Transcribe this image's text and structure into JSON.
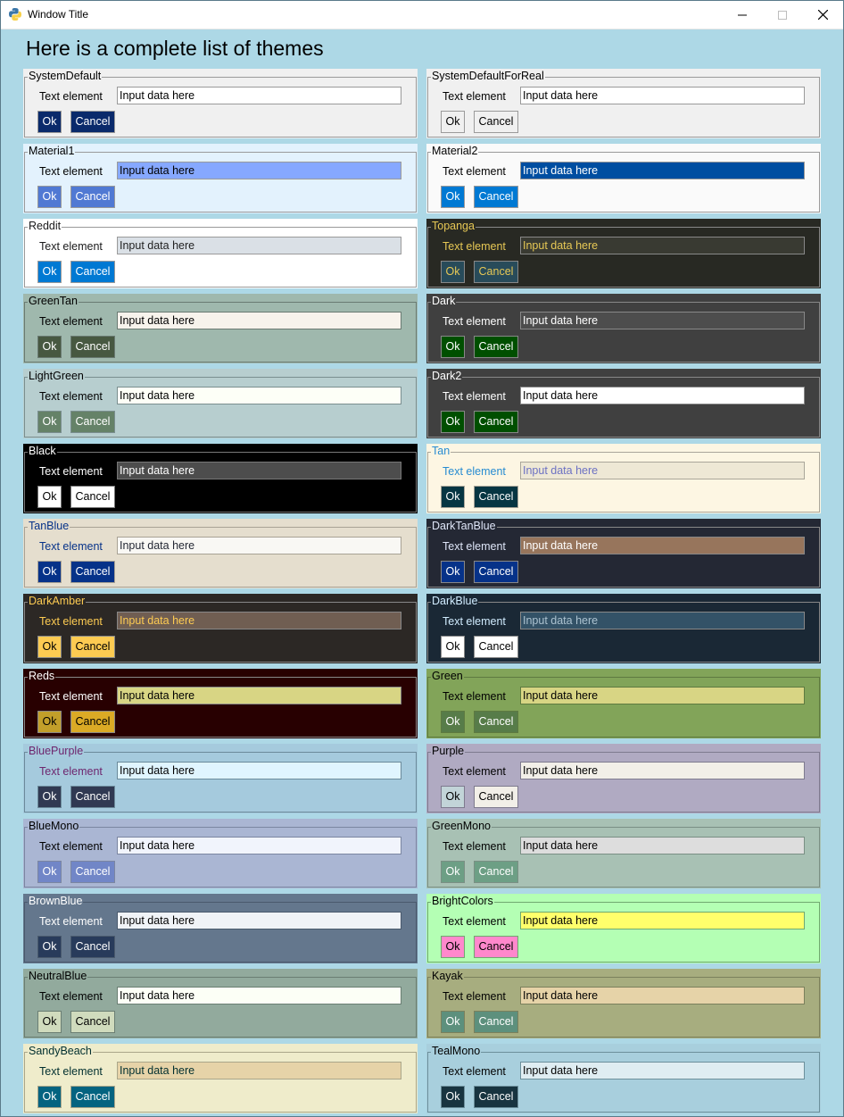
{
  "window": {
    "title": "Window Title",
    "icon": "python-icon"
  },
  "heading": "Here is a complete list of themes",
  "common": {
    "text_label": "Text element",
    "input_value": "Input data here",
    "ok_label": "Ok",
    "cancel_label": "Cancel"
  },
  "themes": [
    {
      "name": "SystemDefault",
      "bg": "#f0f0f0",
      "text": "#000000",
      "input_bg": "#ffffff",
      "input_text": "#000000",
      "button_bg": "#0a2a6b",
      "button_text": "#ffffff",
      "border": "#9a9a9a"
    },
    {
      "name": "SystemDefaultForReal",
      "bg": "#f0f0f0",
      "text": "#000000",
      "input_bg": "#ffffff",
      "input_text": "#000000",
      "button_bg": "#f0f0f0",
      "button_text": "#000000",
      "border": "#9a9a9a"
    },
    {
      "name": "Material1",
      "bg": "#e3f2fd",
      "text": "#000000",
      "input_bg": "#86a8ff",
      "input_text": "#000000",
      "button_bg": "#5079d3",
      "button_text": "#ffffff",
      "border": "#9a9a9a"
    },
    {
      "name": "Material2",
      "bg": "#fafafa",
      "text": "#000000",
      "input_bg": "#004ea1",
      "input_text": "#ffffff",
      "button_bg": "#5079d3",
      "button_text": "#ffffff",
      "border": "#9a9a9a",
      "ok_bg": "#0079d3",
      "cancel_bg": "#0079d3"
    },
    {
      "name": "Reddit",
      "bg": "#ffffff",
      "text": "#1a1a1b",
      "input_bg": "#dae0e6",
      "input_text": "#222222",
      "button_bg": "#0079d3",
      "button_text": "#ffffff",
      "border": "#9a9a9a"
    },
    {
      "name": "Topanga",
      "bg": "#282923",
      "text": "#e7c855",
      "input_bg": "#393a32",
      "input_text": "#e7c855",
      "button_bg": "#284b5a",
      "button_text": "#e7c855",
      "border": "#888888"
    },
    {
      "name": "GreenTan",
      "bg": "#9fb8ad",
      "text": "#000000",
      "input_bg": "#f7f3ec",
      "input_text": "#000000",
      "button_bg": "#475841",
      "button_text": "#ffffff",
      "border": "#6a7a72"
    },
    {
      "name": "Dark",
      "bg": "#404040",
      "text": "#ffffff",
      "input_bg": "#4d4d4d",
      "input_text": "#ffffff",
      "button_bg": "#004f00",
      "button_text": "#ffffff",
      "border": "#888888"
    },
    {
      "name": "LightGreen",
      "bg": "#b7cecf",
      "text": "#000000",
      "input_bg": "#fdfff7",
      "input_text": "#000000",
      "button_bg": "#658268",
      "button_text": "#ffffff",
      "border": "#7a8e8f"
    },
    {
      "name": "Dark2",
      "bg": "#404040",
      "text": "#ffffff",
      "input_bg": "#ffffff",
      "input_text": "#000000",
      "button_bg": "#004f00",
      "button_text": "#ffffff",
      "border": "#888888"
    },
    {
      "name": "Black",
      "bg": "#000000",
      "text": "#ffffff",
      "input_bg": "#4d4d4d",
      "input_text": "#ffffff",
      "button_bg": "#ffffff",
      "button_text": "#000000",
      "border": "#777777"
    },
    {
      "name": "Tan",
      "bg": "#fdf6e3",
      "text": "#268bd1",
      "input_bg": "#eee8d5",
      "input_text": "#6c71c3",
      "button_bg": "#063542",
      "button_text": "#ffffff",
      "border": "#aaa69a"
    },
    {
      "name": "TanBlue",
      "bg": "#e5dece",
      "text": "#063289",
      "input_bg": "#f9f8f4",
      "input_text": "#242834",
      "button_bg": "#063289",
      "button_text": "#ffffff",
      "border": "#a8a295"
    },
    {
      "name": "DarkTanBlue",
      "bg": "#242834",
      "text": "#dfe6f8",
      "input_bg": "#97755c",
      "input_text": "#ffffff",
      "button_bg": "#063289",
      "button_text": "#ffffff",
      "border": "#888888"
    },
    {
      "name": "DarkAmber",
      "bg": "#2c2825",
      "text": "#fdcb52",
      "input_bg": "#705e52",
      "input_text": "#fdcb52",
      "button_bg": "#fdcb52",
      "button_text": "#000000",
      "border": "#888888"
    },
    {
      "name": "DarkBlue",
      "bg": "#1a2835",
      "text": "#d1ecff",
      "input_bg": "#335267",
      "input_text": "#acc2d0",
      "button_bg": "#ffffff",
      "button_text": "#000000",
      "border": "#888888"
    },
    {
      "name": "Reds",
      "bg": "#280001",
      "text": "#ffffff",
      "input_bg": "#d8d584",
      "input_text": "#000000",
      "button_bg": "#c29f2a",
      "button_text": "#000000",
      "border": "#888888",
      "cancel_bg": "#dbaa25"
    },
    {
      "name": "Green",
      "bg": "#82a459",
      "text": "#000000",
      "input_bg": "#d8d584",
      "input_text": "#000000",
      "button_bg": "#577c49",
      "button_text": "#ffffff",
      "border": "#5e7a40"
    },
    {
      "name": "BluePurple",
      "bg": "#a5cadd",
      "text": "#6e266e",
      "input_bg": "#e0f5ff",
      "input_text": "#000000",
      "button_bg": "#303952",
      "button_text": "#ffffff",
      "border": "#6b8a9a"
    },
    {
      "name": "Purple",
      "bg": "#b0aac2",
      "text": "#000000",
      "input_bg": "#f2efe8",
      "input_text": "#000000",
      "button_bg": "#c2d4d8",
      "button_text": "#000000",
      "border": "#7e7a8e",
      "cancel_bg": "#f2efe8"
    },
    {
      "name": "BlueMono",
      "bg": "#aab6d3",
      "text": "#000000",
      "input_bg": "#f1f4fc",
      "input_text": "#000000",
      "button_bg": "#7186c7",
      "button_text": "#ffffff",
      "border": "#7b86a1"
    },
    {
      "name": "GreenMono",
      "bg": "#a8c1b4",
      "text": "#000000",
      "input_bg": "#dddddd",
      "input_text": "#000000",
      "button_bg": "#6d9f85",
      "button_text": "#ffffff",
      "border": "#7a8f84"
    },
    {
      "name": "BrownBlue",
      "bg": "#64778d",
      "text": "#ffffff",
      "input_bg": "#f0f3f7",
      "input_text": "#000000",
      "button_bg": "#283b5b",
      "button_text": "#ffffff",
      "border": "#4a5a6d"
    },
    {
      "name": "BrightColors",
      "bg": "#b4ffb4",
      "text": "#000000",
      "input_bg": "#ffff6b",
      "input_text": "#000000",
      "button_bg": "#ff88cc",
      "button_text": "#000000",
      "border": "#70a870"
    },
    {
      "name": "NeutralBlue",
      "bg": "#92aa9d",
      "text": "#000000",
      "input_bg": "#fcfff6",
      "input_text": "#000000",
      "button_bg": "#d0dbbd",
      "button_text": "#000000",
      "border": "#6a7e73"
    },
    {
      "name": "Kayak",
      "bg": "#a7ad7f",
      "text": "#000000",
      "input_bg": "#e6d3a8",
      "input_text": "#000000",
      "button_bg": "#5d907d",
      "button_text": "#ffffff",
      "border": "#7b805c"
    },
    {
      "name": "SandyBeach",
      "bg": "#efeccb",
      "text": "#012f2f",
      "input_bg": "#e6d3a8",
      "input_text": "#012f2f",
      "button_bg": "#046380",
      "button_text": "#ffffff",
      "border": "#aaa68a"
    },
    {
      "name": "TealMono",
      "bg": "#a8cfdd",
      "text": "#000000",
      "input_bg": "#dfedf2",
      "input_text": "#000000",
      "button_bg": "#183440",
      "button_text": "#ffffff",
      "border": "#6c8f9b"
    }
  ]
}
